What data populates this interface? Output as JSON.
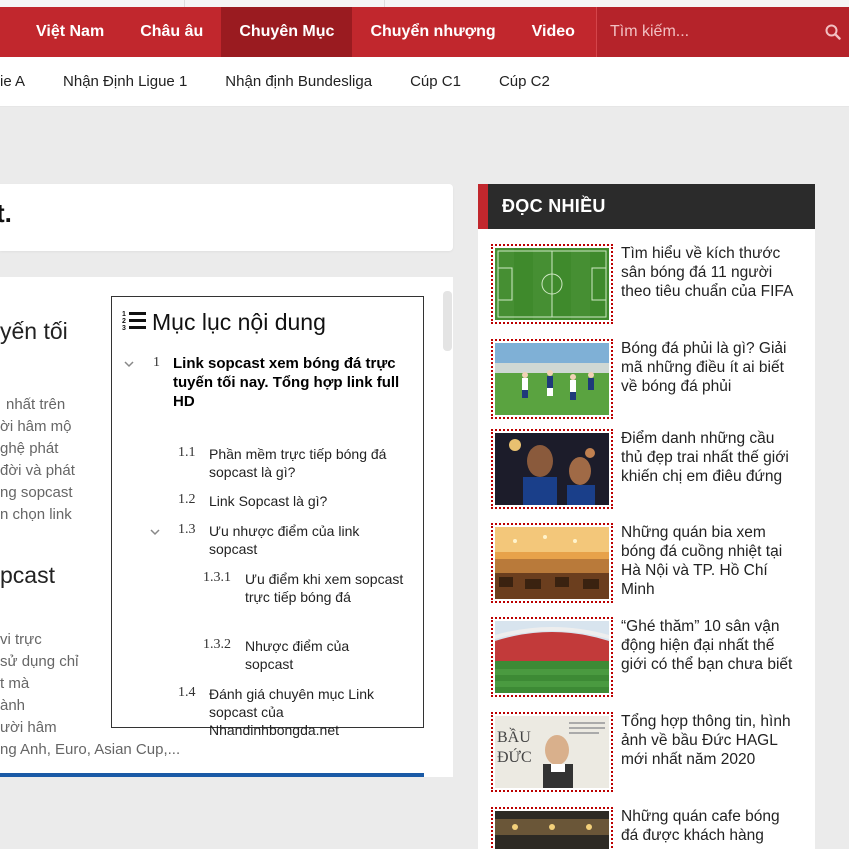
{
  "navbar": {
    "items": [
      {
        "label": "Việt Nam"
      },
      {
        "label": "Châu âu"
      },
      {
        "label": "Chuyên Mục"
      },
      {
        "label": "Chuyển nhượng"
      },
      {
        "label": "Video"
      }
    ],
    "active_index": 2,
    "search_placeholder": "Tìm kiếm..."
  },
  "subnav": {
    "items": [
      {
        "label": "ie A"
      },
      {
        "label": "Nhận Định Ligue 1"
      },
      {
        "label": "Nhận định Bundesliga"
      },
      {
        "label": "Cúp C1"
      },
      {
        "label": "Cúp C2"
      }
    ]
  },
  "article": {
    "title_fragment": "t.",
    "body_fragments": {
      "heading1": "yến tối",
      "para1": [
        "nhất trên",
        "ời hâm mộ",
        "ghệ phát",
        "đời và phát",
        "ng sopcast",
        "n chọn link"
      ],
      "heading2": "pcast",
      "para2": [
        "vi trực",
        "sử dụng chỉ",
        "t mà",
        "ành",
        "ười hâm",
        "ng Anh, Euro, Asian Cup,..."
      ]
    }
  },
  "toc": {
    "title": "Mục lục nội dung",
    "items": [
      {
        "num": "1",
        "text": "Link sopcast xem bóng đá trực tuyến tối nay. Tổng hợp link full HD"
      },
      {
        "num": "1.1",
        "text": "Phần mềm trực tiếp bóng đá sopcast là gì?"
      },
      {
        "num": "1.2",
        "text": "Link Sopcast là gì?"
      },
      {
        "num": "1.3",
        "text": "Ưu nhược điểm của link sopcast"
      },
      {
        "num": "1.3.1",
        "text": "Ưu điểm khi xem sopcast trực tiếp bóng đá"
      },
      {
        "num": "1.3.2",
        "text": "Nhược điểm của sopcast"
      },
      {
        "num": "1.4",
        "text": "Đánh giá chuyên mục Link sopcast của Nhandinhbongda.net"
      }
    ]
  },
  "sidebar": {
    "header": "ĐỌC NHIỀU",
    "articles": [
      {
        "title": "Tìm hiểu về kích thước sân bóng đá 11 người theo tiêu chuẩn của FIFA"
      },
      {
        "title": "Bóng đá phủi là gì? Giải mã những điều ít ai biết về bóng đá phủi"
      },
      {
        "title": "Điểm danh những cầu thủ đẹp trai nhất thế giới khiến chị em điêu đứng"
      },
      {
        "title": "Những quán bia xem bóng đá cuồng nhiệt tại Hà Nội và TP. Hồ Chí Minh"
      },
      {
        "title": "“Ghé thăm” 10 sân vận động hiện đại nhất thế giới có thể bạn chưa biết"
      },
      {
        "title": "Tổng hợp thông tin, hình ảnh về bầu Đức HAGL mới nhất năm 2020"
      },
      {
        "title": "Những quán cafe bóng đá được khách hàng"
      }
    ],
    "thumb6_text": [
      "BẦU",
      "ĐỨC"
    ]
  },
  "colors": {
    "brand_red": "#c1272d",
    "active_nav": "#9a1b20",
    "sidebar_header_bg": "#2b2b2b",
    "toc_border": "#333333",
    "accent_blue": "#1a5aa6"
  }
}
